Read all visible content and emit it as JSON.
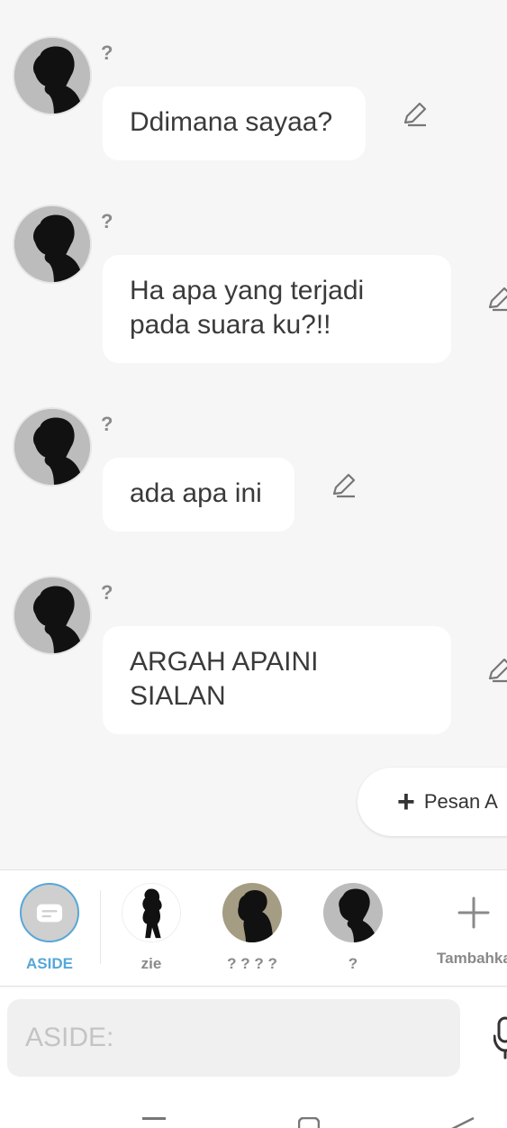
{
  "messages": [
    {
      "sender": "?",
      "text": "Ddimana sayaa?"
    },
    {
      "sender": "?",
      "text": "Ha apa yang terjadi pada suara ku?!!"
    },
    {
      "sender": "?",
      "text": "ada apa ini"
    },
    {
      "sender": "?",
      "text": "ARGAH APAINI SIALAN"
    }
  ],
  "fab": {
    "label": "Pesan A"
  },
  "characters": [
    {
      "label": "ASIDE",
      "icon": "chat-bubble-icon"
    },
    {
      "label": "zie",
      "icon": "girl-silhouette-avatar"
    },
    {
      "label": "? ? ? ?",
      "icon": "boy-silhouette-avatar"
    },
    {
      "label": "?",
      "icon": "boy-silhouette-avatar"
    },
    {
      "label": "Tambahka",
      "icon": "plus-icon"
    }
  ],
  "input": {
    "placeholder": "ASIDE:"
  },
  "colors": {
    "accent": "#56a7d8",
    "bubble": "#ffffff",
    "background": "#f6f6f6",
    "avatar_bg": "#bdbcbc"
  }
}
